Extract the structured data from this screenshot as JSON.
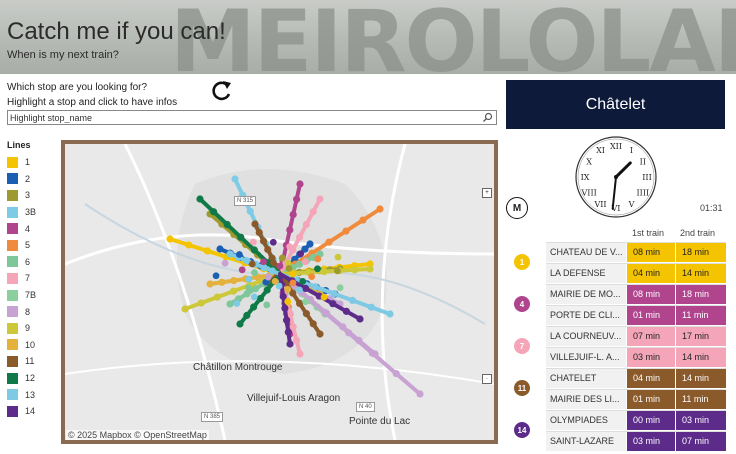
{
  "header": {
    "title": "Catch me if you can!",
    "subtitle": "When is my next train?"
  },
  "search": {
    "question": "Which stop are you looking for?",
    "hint": "Highlight a stop and click to have infos",
    "value": "Highlight stop_name"
  },
  "station": {
    "name": "Châtelet"
  },
  "legend": {
    "title": "Lines",
    "items": [
      {
        "label": "1",
        "color": "#f5c400"
      },
      {
        "label": "2",
        "color": "#1a5fb4"
      },
      {
        "label": "3",
        "color": "#9f9a2f"
      },
      {
        "label": "3B",
        "color": "#7ecbe6"
      },
      {
        "label": "4",
        "color": "#b0458e"
      },
      {
        "label": "5",
        "color": "#f08a3c"
      },
      {
        "label": "6",
        "color": "#7fc79a"
      },
      {
        "label": "7",
        "color": "#f4a6b8"
      },
      {
        "label": "7B",
        "color": "#8ccf9e"
      },
      {
        "label": "8",
        "color": "#c8a2d2"
      },
      {
        "label": "9",
        "color": "#cdc83a"
      },
      {
        "label": "10",
        "color": "#e4b13c"
      },
      {
        "label": "11",
        "color": "#8b5a2b"
      },
      {
        "label": "12",
        "color": "#0f7a47"
      },
      {
        "label": "13",
        "color": "#7ec9e3"
      },
      {
        "label": "14",
        "color": "#5d2b8a"
      }
    ]
  },
  "map": {
    "places": [
      "Châtillon Montrouge",
      "Villejuif-Louis Aragon",
      "Pointe du Lac"
    ],
    "roads": [
      "N 315",
      "N 385",
      "N 40"
    ],
    "attribution": "© 2025 Mapbox  © OpenStreetMap"
  },
  "clock": {
    "time": "01:31"
  },
  "metro_logo": "M",
  "table": {
    "headers": [
      "1st train",
      "2nd train"
    ],
    "groups": [
      {
        "line": "1",
        "color": "#f5c400",
        "text_color": "#222",
        "rows": [
          {
            "name": "CHATEAU DE V...",
            "first": "08 min",
            "second": "18 min"
          },
          {
            "name": "LA DEFENSE",
            "first": "04 min",
            "second": "14 min"
          }
        ]
      },
      {
        "line": "4",
        "color": "#b0458e",
        "text_color": "#fff",
        "rows": [
          {
            "name": "MAIRIE DE MO...",
            "first": "08 min",
            "second": "18 min"
          },
          {
            "name": "PORTE DE CLI...",
            "first": "01 min",
            "second": "11 min"
          }
        ]
      },
      {
        "line": "7",
        "color": "#f4a6b8",
        "text_color": "#222",
        "rows": [
          {
            "name": "LA COURNEUV...",
            "first": "07 min",
            "second": "17 min"
          },
          {
            "name": "VILLEJUIF-L. A...",
            "first": "03 min",
            "second": "14 min"
          }
        ]
      },
      {
        "line": "11",
        "color": "#8b5a2b",
        "text_color": "#fff",
        "rows": [
          {
            "name": "CHATELET",
            "first": "04 min",
            "second": "14 min"
          },
          {
            "name": "MAIRIE DES LI...",
            "first": "01 min",
            "second": "11 min"
          }
        ]
      },
      {
        "line": "14",
        "color": "#5d2b8a",
        "text_color": "#fff",
        "rows": [
          {
            "name": "OLYMPIADES",
            "first": "00 min",
            "second": "03 min"
          },
          {
            "name": "SAINT-LAZARE",
            "first": "03 min",
            "second": "07 min"
          }
        ]
      }
    ]
  }
}
